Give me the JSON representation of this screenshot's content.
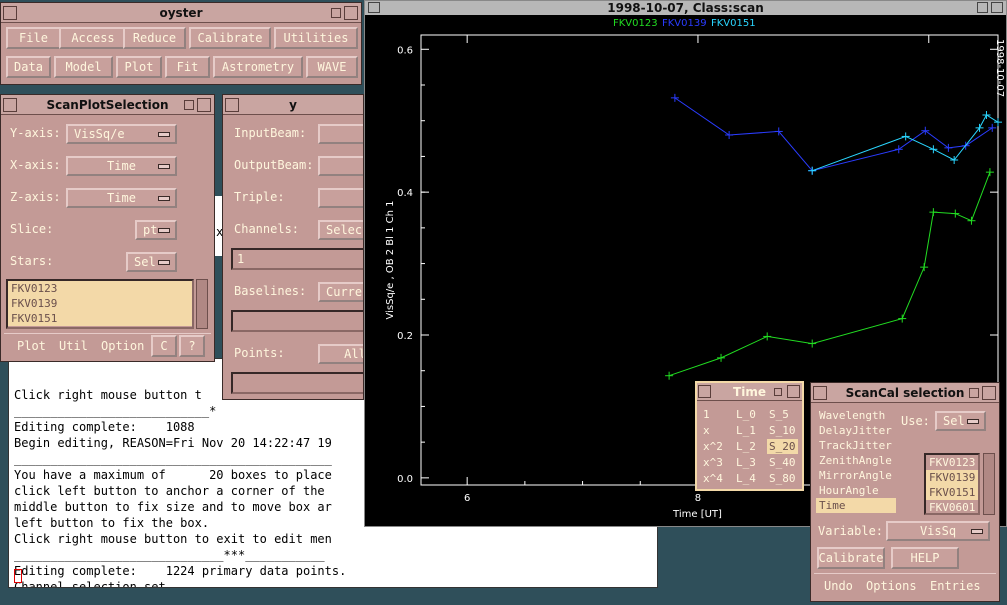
{
  "terminal": {
    "lines": [
      "Click right mouse button t",
      "___________________________*",
      "Editing complete:    1088 ",
      "Begin editing, REASON=Fri Nov 20 14:22:47 19",
      "____________________________________________",
      "You have a maximum of      20 boxes to place",
      "click left button to anchor a corner of the ",
      "middle button to fix size and to move box ar",
      "left button to fix the box.",
      "Click right mouse button to exit to edit men",
      "_____________________________***___________",
      "Editing complete:    1224 primary data points.",
      "Channel selection set."
    ],
    "frag_x": "x",
    "frag_k": "k"
  },
  "oyster": {
    "title": "oyster",
    "row1": [
      "File",
      "Access",
      "Reduce",
      "Calibrate",
      "Utilities"
    ],
    "row2": [
      "Data",
      "Model",
      "Plot",
      "Fit",
      "Astrometry",
      "WAVE"
    ]
  },
  "scanplot": {
    "title": "ScanPlotSelection",
    "yaxis_label": "Y-axis:",
    "yaxis_value": "VisSq/e",
    "xaxis_label": "X-axis:",
    "xaxis_value": "Time",
    "zaxis_label": "Z-axis:",
    "zaxis_value": "Time",
    "slice_label": "Slice:",
    "slice_value": "pt",
    "stars_label": "Stars:",
    "stars_value": "Sel",
    "stars": [
      "FKV0123",
      "FKV0139",
      "FKV0151"
    ],
    "bottom": {
      "plot": "Plot",
      "util": "Util",
      "option": "Option",
      "c": "C",
      "help": "?"
    }
  },
  "ywin": {
    "title": "y",
    "inputbeam": "InputBeam:",
    "outputbeam": "OutputBeam:",
    "triple": "Triple:",
    "channels": "Channels:",
    "channels_value": "Select",
    "field1": "1",
    "baselines": "Baselines:",
    "baselines_value": "Curre",
    "points": "Points:",
    "points_value": "All"
  },
  "plotwin": {
    "title": "1998-10-07, Class:scan",
    "legend": [
      {
        "name": "FKV0123",
        "color": "#22dd22"
      },
      {
        "name": "FKV0139",
        "color": "#2a3cff"
      },
      {
        "name": "FKV0151",
        "color": "#2ad6ff"
      }
    ],
    "side_date": "1998-10-07"
  },
  "chart_data": {
    "type": "line",
    "title": "",
    "xlabel": "Time [UT]",
    "ylabel": "VisSq/e , OB 2 Bl 1 Ch 1",
    "xlim": [
      5.6,
      10.6
    ],
    "ylim": [
      -0.01,
      0.62
    ],
    "xticks": [
      "6",
      "8",
      "10"
    ],
    "yticks": [
      "0.0",
      "0.2",
      "0.4",
      "0.6"
    ],
    "grid": false,
    "series": [
      {
        "name": "FKV0123",
        "color": "#22dd22",
        "x": [
          7.75,
          8.2,
          8.6,
          8.99,
          9.77,
          9.96,
          10.04,
          10.23,
          10.37,
          10.53
        ],
        "y": [
          0.143,
          0.168,
          0.198,
          0.188,
          0.223,
          0.295,
          0.372,
          0.37,
          0.36,
          0.428
        ]
      },
      {
        "name": "FKV0139",
        "color": "#2a3cff",
        "x": [
          7.8,
          8.27,
          8.7,
          8.99,
          9.74,
          9.97,
          10.17,
          10.32,
          10.55
        ],
        "y": [
          0.532,
          0.48,
          0.485,
          0.43,
          0.46,
          0.486,
          0.462,
          0.465,
          0.49
        ]
      },
      {
        "name": "FKV0151",
        "color": "#2ad6ff",
        "x": [
          8.99,
          9.8,
          10.04,
          10.22,
          10.44,
          10.5,
          10.6
        ],
        "y": [
          0.43,
          0.478,
          0.46,
          0.445,
          0.49,
          0.508,
          0.498
        ]
      }
    ]
  },
  "timewin": {
    "title": "Time",
    "col1": [
      "1",
      "x",
      "x^2",
      "x^3",
      "x^4"
    ],
    "col2": [
      "L_0",
      "L_1",
      "L_2",
      "L_3",
      "L_4"
    ],
    "col3": [
      "S_5",
      "S_10",
      "S_20",
      "S_40",
      "S_80"
    ],
    "selected": "S_20"
  },
  "scancal": {
    "title": "ScanCal selection",
    "params": [
      "Wavelength",
      "DelayJitter",
      "TrackJitter",
      "ZenithAngle",
      "MirrorAngle",
      "HourAngle",
      "Time"
    ],
    "selected_param": "Time",
    "use_label": "Use:",
    "use_value": "Sel",
    "stars": [
      "FKV0123",
      "FKV0139",
      "FKV0151",
      "FKV0601"
    ],
    "highlighted_stars": [
      "FKV0139",
      "FKV0151"
    ],
    "variable_label": "Variable:",
    "variable_value": "VisSq",
    "calibrate": "Calibrate",
    "help": "HELP",
    "undo": "Undo",
    "options": "Options",
    "entries": "Entries"
  }
}
